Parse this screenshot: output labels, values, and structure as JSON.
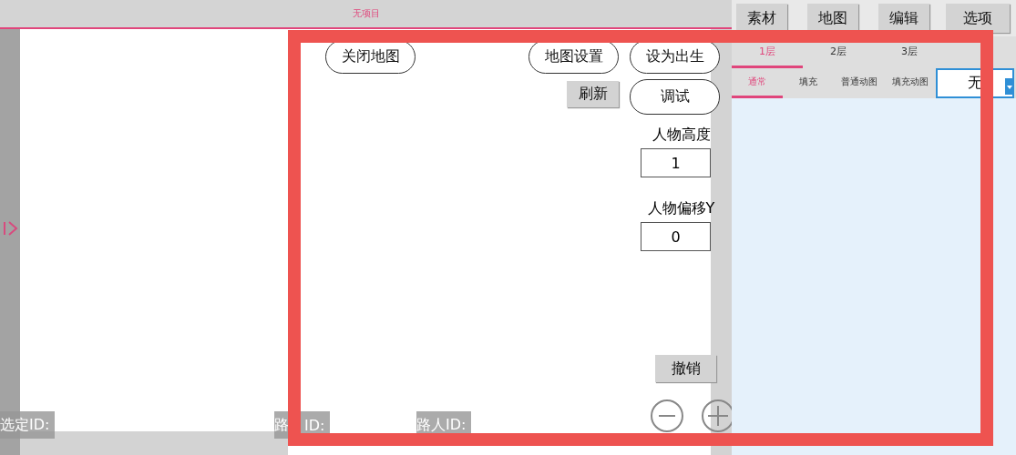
{
  "title": "无项目",
  "nav_buttons": [
    "素材",
    "地图",
    "编辑",
    "选项"
  ],
  "layer_tabs": [
    {
      "label": "1层",
      "selected": true
    },
    {
      "label": "2层",
      "selected": false
    },
    {
      "label": "3层",
      "selected": false
    }
  ],
  "brush_tabs": [
    {
      "label": "通常",
      "selected": true
    },
    {
      "label": "填充",
      "selected": false
    },
    {
      "label": "普通动图",
      "selected": false
    },
    {
      "label": "填充动图",
      "selected": false
    }
  ],
  "dropdown": {
    "value": "无"
  },
  "map_buttons": {
    "close_map": "关闭地图",
    "map_settings": "地图设置",
    "set_spawn": "设为出生",
    "refresh": "刷新",
    "debug": "调试",
    "undo": "撤销"
  },
  "fields": [
    {
      "label": "人物高度",
      "value": "1"
    },
    {
      "label": "人物偏移Y",
      "value": "0"
    }
  ],
  "status_labels": [
    {
      "parts": [
        "选定ID:"
      ]
    },
    {
      "parts": [
        "路",
        "ID:"
      ]
    },
    {
      "parts": [
        "路人ID:"
      ]
    }
  ]
}
